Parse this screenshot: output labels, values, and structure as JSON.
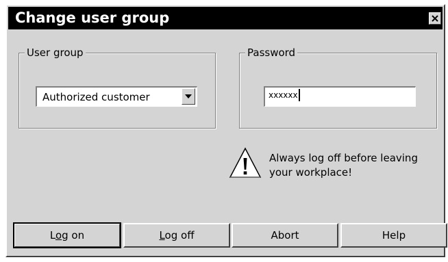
{
  "dialog": {
    "title": "Change user group",
    "close_icon": "close-x-icon"
  },
  "user_group": {
    "label": "User group",
    "selected": "Authorized customer",
    "dropdown_icon": "chevron-down-icon"
  },
  "password": {
    "label": "Password",
    "value": "xxxxxx"
  },
  "warning": {
    "icon": "warning-triangle-icon",
    "text": "Always log off before leaving your workplace!"
  },
  "buttons": {
    "log_on": {
      "prefix": "L",
      "accel": "o",
      "suffix": "g on"
    },
    "log_off": {
      "prefix": "",
      "accel": "L",
      "suffix": "og off"
    },
    "abort": "Abort",
    "help": "Help"
  }
}
